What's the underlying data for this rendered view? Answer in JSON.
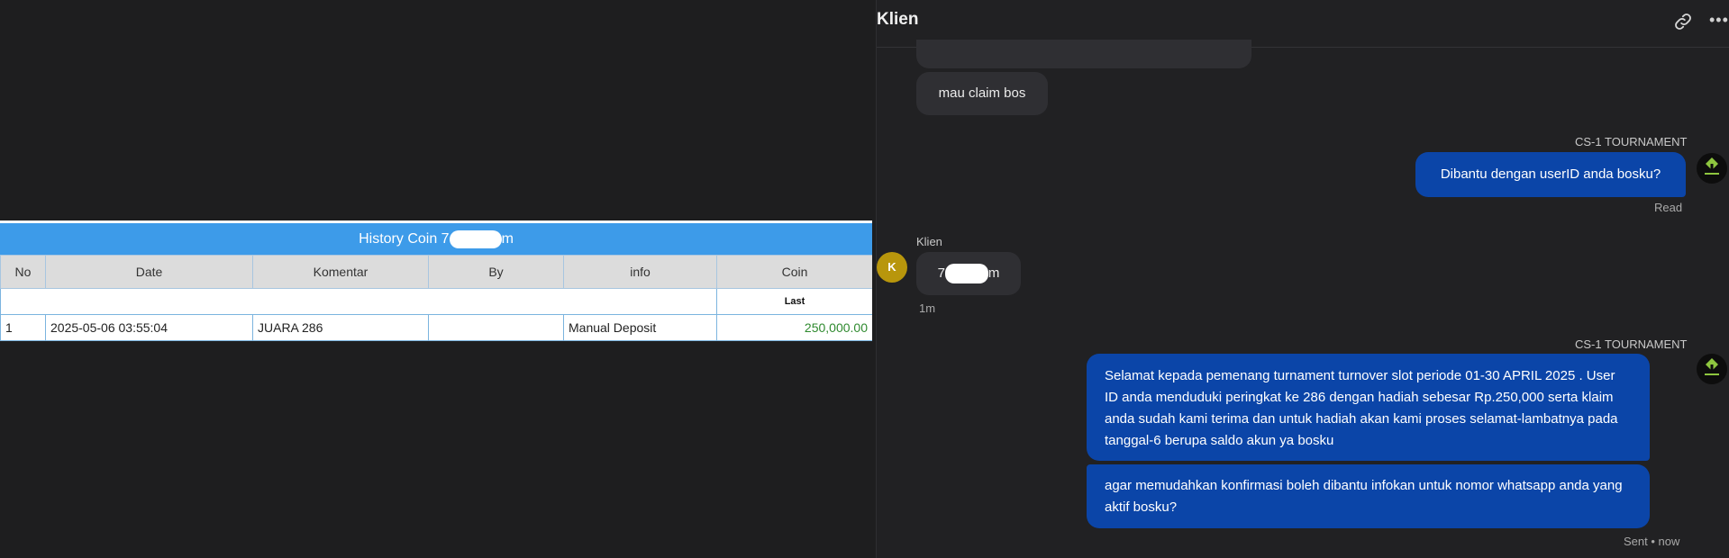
{
  "history_table": {
    "title_prefix": "History Coin 7",
    "title_suffix": "m",
    "columns": [
      "No",
      "Date",
      "Komentar",
      "By",
      "info",
      "Coin"
    ],
    "subheader_last": "Last",
    "rows": [
      {
        "no": "1",
        "date": "2025-05-06 03:55:04",
        "komentar": "JUARA 286",
        "by": "",
        "info": "Manual Deposit",
        "coin": "250,000.00"
      }
    ]
  },
  "chat": {
    "header_title": "Klien",
    "header_icons": [
      "link-icon",
      "more-icon"
    ],
    "messages": [
      {
        "side": "in",
        "text": "mau claim bos"
      },
      {
        "side": "out",
        "agent": "CS-1 TOURNAMENT",
        "text": "Dibantu dengan userID anda bosku?",
        "status": "Read"
      },
      {
        "side": "in",
        "sender": "Klien",
        "avatar_letter": "K",
        "text_prefix": "7",
        "text_suffix": "m",
        "time": "1m"
      },
      {
        "side": "out",
        "agent": "CS-1 TOURNAMENT",
        "text": "Selamat kepada pemenang turnament turnover slot periode 01-30 APRIL 2025 . User ID anda menduduki peringkat ke 286 dengan hadiah sebesar Rp.250,000 serta klaim anda sudah kami terima dan untuk hadiah akan kami proses selamat-lambatnya pada tanggal-6 berupa saldo akun ya bosku"
      },
      {
        "side": "out",
        "text": "agar memudahkan konfirmasi boleh dibantu infokan untuk nomor whatsapp anda yang aktif bosku?",
        "status": "Sent • now"
      }
    ]
  },
  "colors": {
    "table_header_blue": "#3d9be9",
    "coin_green": "#2f8a2f",
    "outgoing_bubble": "#0b45a8",
    "incoming_bubble": "#2f2f33",
    "avatar_k": "#b8960c"
  }
}
